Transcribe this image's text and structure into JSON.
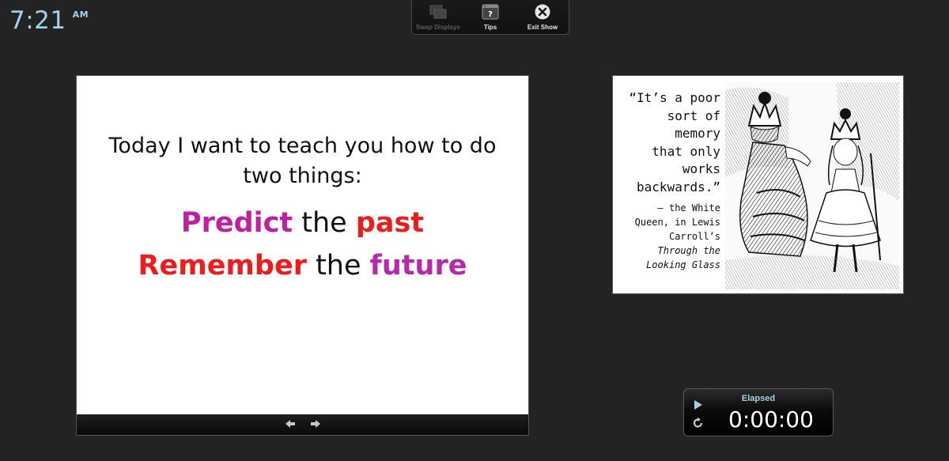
{
  "clock": {
    "time": "7:21",
    "ampm": "AM"
  },
  "toolbar": {
    "swap_label": "Swap Displays",
    "tips_label": "Tips",
    "exit_label": "Exit Show"
  },
  "current_slide": {
    "intro": "Today I want to teach you how to do two things:",
    "line1": {
      "word1": "Predict",
      "word2": " the ",
      "word3": "past"
    },
    "line2": {
      "word1": "Remember",
      "word2": " the ",
      "word3": "future"
    }
  },
  "next_slide": {
    "quote_lines": [
      "“It’s a poor",
      "sort of",
      "memory",
      "that only",
      "works",
      "backwards.”"
    ],
    "attribution_lines": [
      "– the White",
      "Queen, in Lewis",
      "Carroll’s"
    ],
    "book_lines": [
      "Through the",
      "Looking Glass"
    ]
  },
  "timer": {
    "label": "Elapsed",
    "value": "0:00:00"
  },
  "colors": {
    "background": "#232323",
    "clock": "#9fd3ee",
    "magenta": "#bf1fa0",
    "red": "#ee1c1c",
    "timer_label": "#a8cfe2"
  }
}
